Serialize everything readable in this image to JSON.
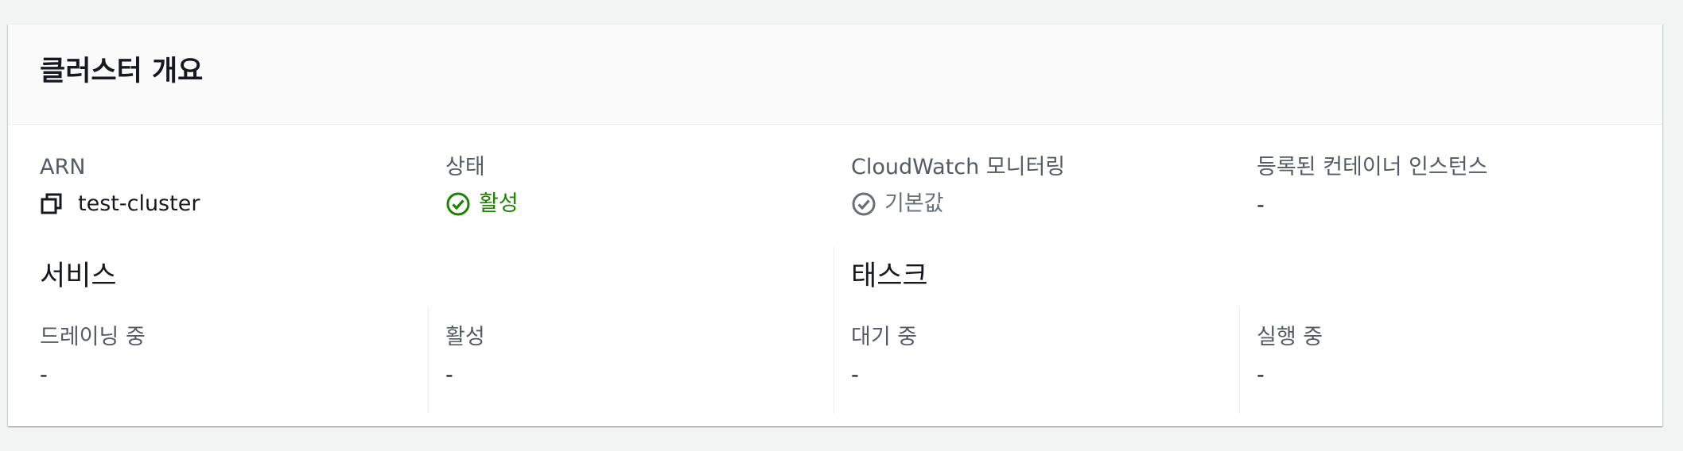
{
  "panel": {
    "title": "클러스터 개요"
  },
  "summary": {
    "arn": {
      "label": "ARN",
      "value": "test-cluster",
      "icon": "copy-icon"
    },
    "status": {
      "label": "상태",
      "value": "활성",
      "icon": "check-circle-icon",
      "color": "#1d8102"
    },
    "cloudwatch": {
      "label": "CloudWatch 모니터링",
      "value": "기본값",
      "icon": "check-circle-icon",
      "color": "#687078"
    },
    "instances": {
      "label": "등록된 컨테이너 인스턴스",
      "value": "-"
    }
  },
  "services": {
    "title": "서비스",
    "draining": {
      "label": "드레이닝 중",
      "value": "-"
    },
    "active": {
      "label": "활성",
      "value": "-"
    }
  },
  "tasks": {
    "title": "태스크",
    "pending": {
      "label": "대기 중",
      "value": "-"
    },
    "running": {
      "label": "실행 중",
      "value": "-"
    }
  }
}
